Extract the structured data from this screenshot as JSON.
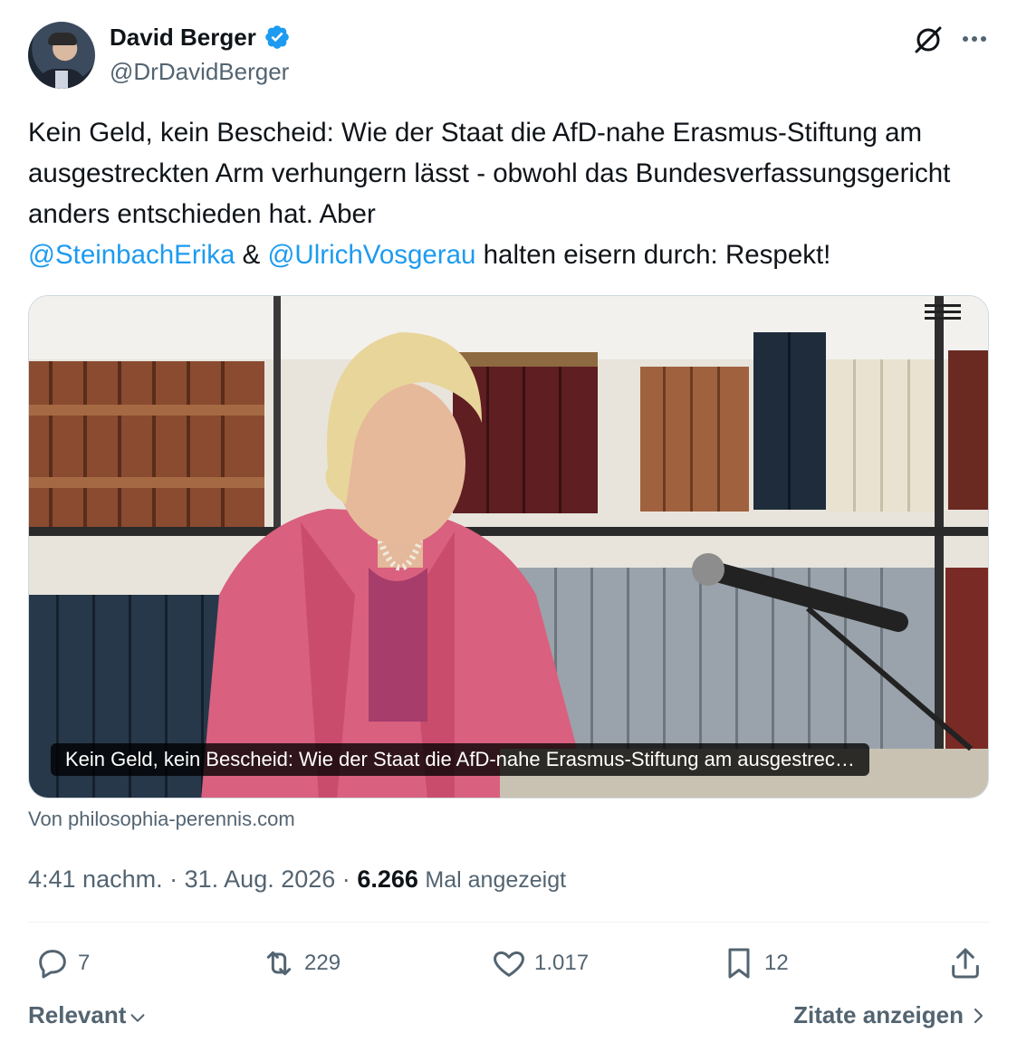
{
  "author": {
    "name": "David Berger",
    "handle": "@DrDavidBerger",
    "verified": true
  },
  "tweet": {
    "text_part1": "Kein Geld, kein Bescheid: Wie der Staat die AfD-nahe Erasmus-Stiftung am ausgestreckten Arm verhungern lässt - obwohl das Bundesverfassungsgericht anders entschieden hat.  Aber ",
    "mention1": "@SteinbachErika",
    "between": " & ",
    "mention2": "@UlrichVosgerau",
    "text_part2": "  halten eisern durch: Respekt!"
  },
  "media": {
    "caption": "Kein Geld, kein Bescheid: Wie der Staat die AfD-nahe Erasmus-Stiftung am ausgestrec…",
    "source": "Von philosophia-perennis.com",
    "image_description_icon": "video-thumbnail"
  },
  "meta": {
    "time": "4:41 nachm.",
    "separator": "·",
    "date": "31. Aug. 2026",
    "views_count": "6.266",
    "views_label": "Mal angezeigt"
  },
  "actions": {
    "replies": "7",
    "retweets": "229",
    "likes": "1.017",
    "bookmarks": "12"
  },
  "footer": {
    "sort_label": "Relevant",
    "quotes_label": "Zitate anzeigen"
  },
  "colors": {
    "accent": "#1d9bf0",
    "text": "#0f1419",
    "muted": "#536471"
  }
}
